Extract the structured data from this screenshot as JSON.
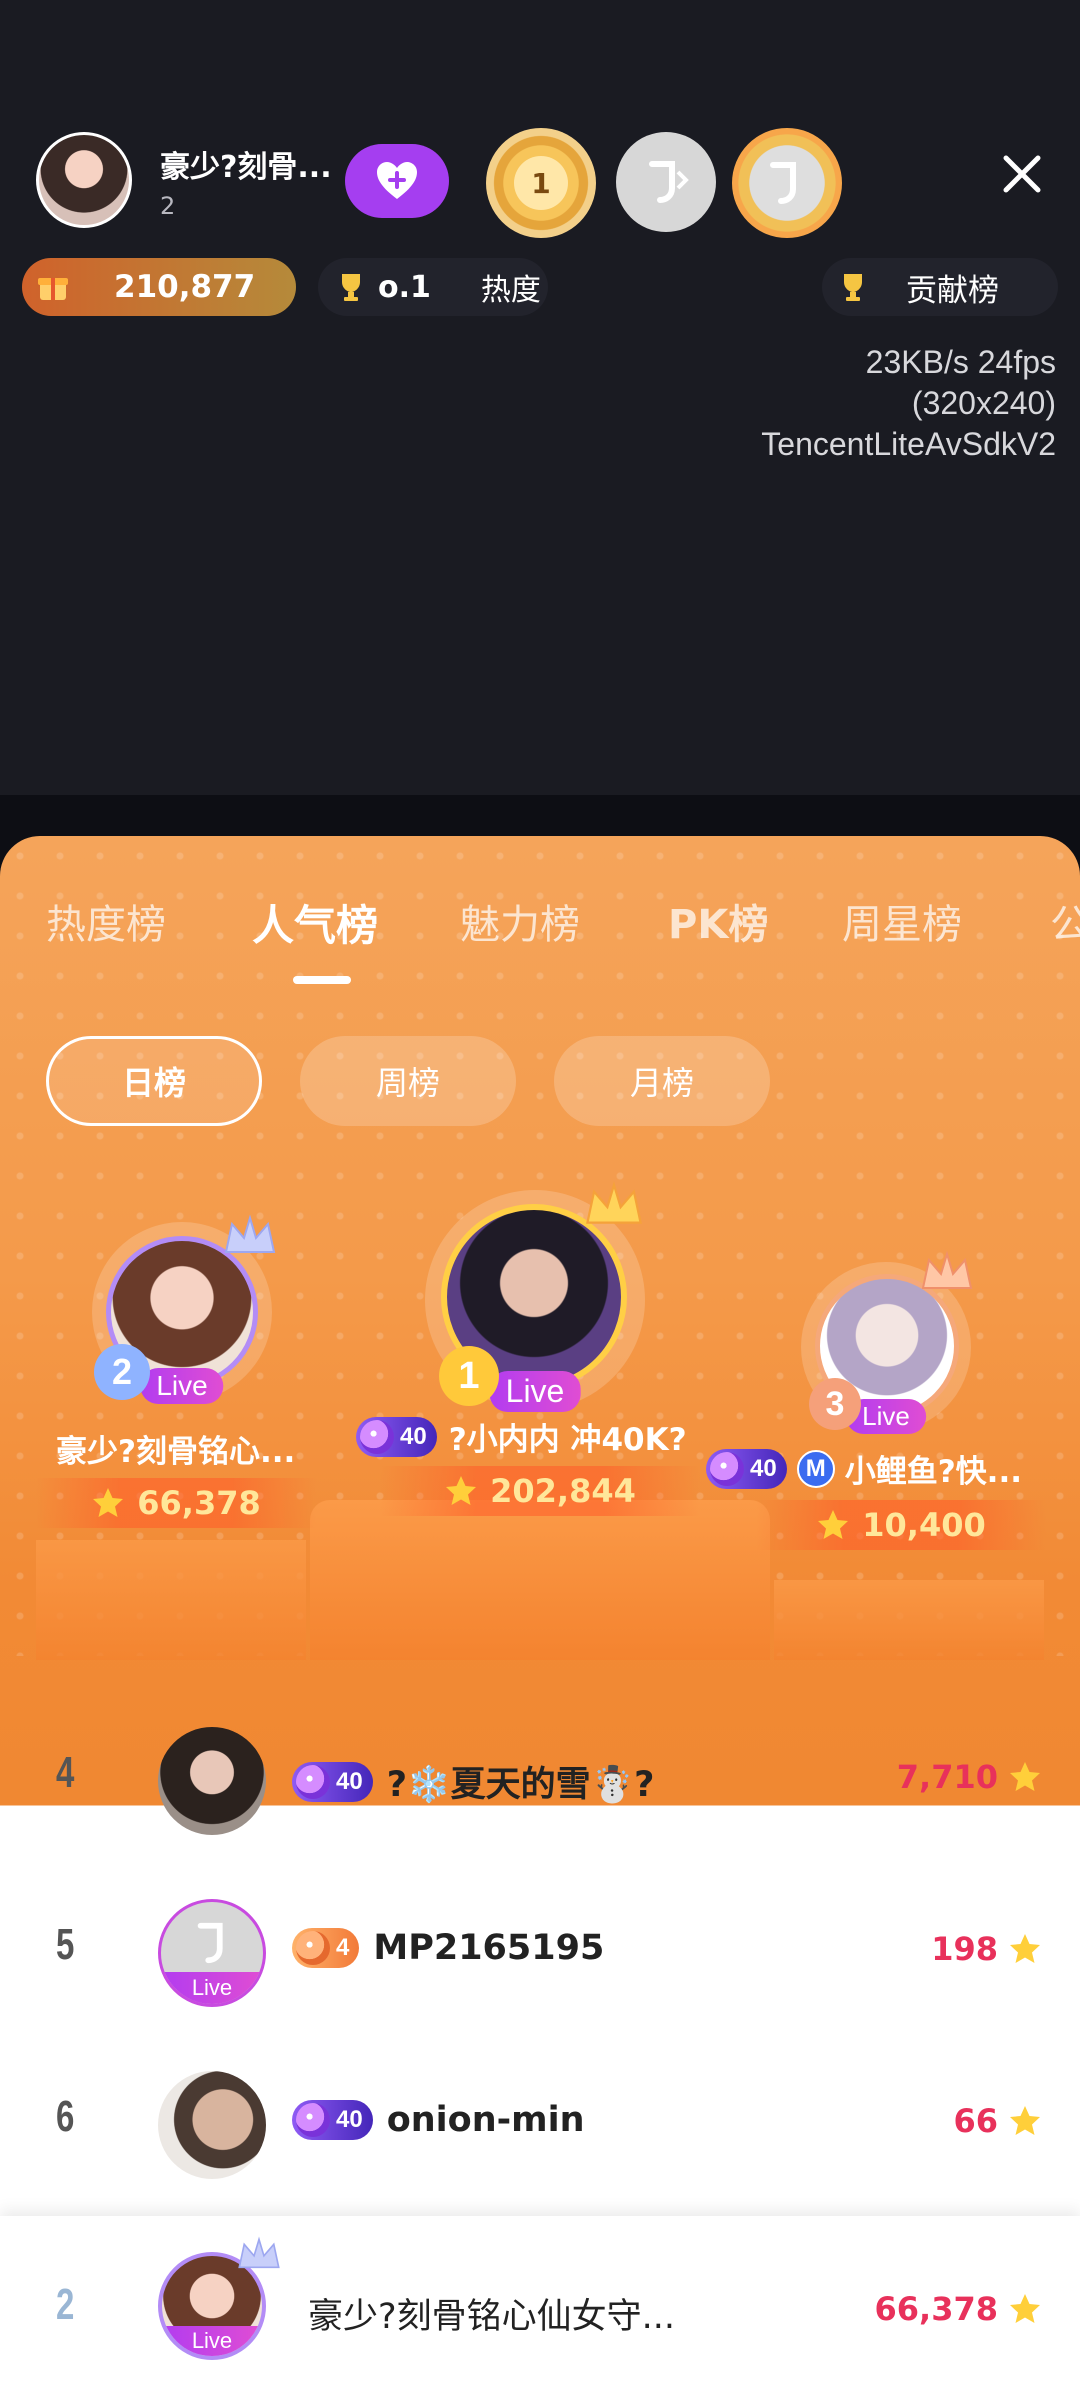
{
  "host": {
    "name": "豪少?刻骨...",
    "sub": "2"
  },
  "medals": {
    "first": "1"
  },
  "top_bar": {
    "gift_value": "210,877",
    "rank_text": "o.1",
    "rank_label": "热度",
    "contrib_label": "贡献榜"
  },
  "debug": {
    "line1": "23KB/s 24fps",
    "line2": "(320x240)",
    "line3": "TencentLiteAvSdkV2"
  },
  "tabs": [
    "热度榜",
    "人气榜",
    "魅力榜",
    "PK榜",
    "周星榜",
    "公"
  ],
  "subtabs": [
    "日榜",
    "周榜",
    "月榜"
  ],
  "top3": [
    {
      "rank": "2",
      "name": "豪少?刻骨铭心...",
      "score": "66,378",
      "live": "Live"
    },
    {
      "rank": "1",
      "name": "?小内内 冲40K?",
      "score": "202,844",
      "live": "Live",
      "level": "40"
    },
    {
      "rank": "3",
      "name": "小鲤鱼?快...",
      "score": "10,400",
      "live": "Live",
      "level": "40",
      "badge": "M"
    }
  ],
  "list": [
    {
      "rank": "4",
      "name": "?❄️夏天的雪☃️?",
      "score": "7,710",
      "level": "40"
    },
    {
      "rank": "5",
      "name": "MP2165195",
      "score": "198",
      "level": "4",
      "live": "Live"
    },
    {
      "rank": "6",
      "name": "onion-min",
      "score": "66",
      "level": "40"
    }
  ],
  "me": {
    "rank": "2",
    "name": "豪少?刻骨铭心仙女守...",
    "score": "66,378",
    "live": "Live"
  },
  "colors": {
    "accent_purple": "#a53ef0",
    "panel_orange": "#f49a4a",
    "score_red": "#e8315b",
    "gold": "#ffe79a"
  }
}
